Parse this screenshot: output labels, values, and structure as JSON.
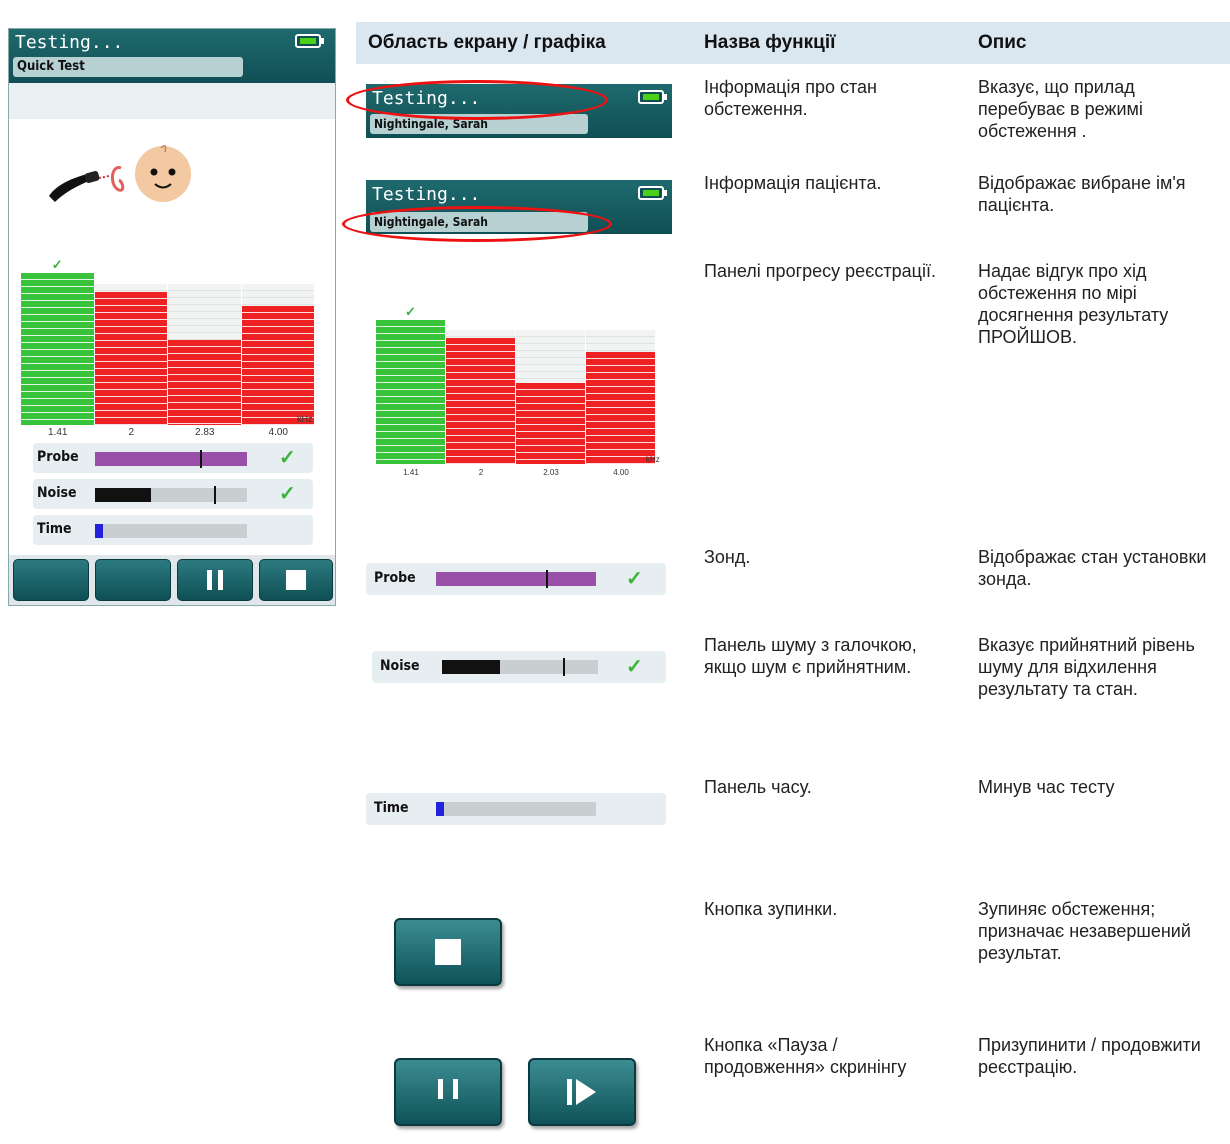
{
  "device": {
    "status_title": "Testing...",
    "test_name": "Quick Test",
    "bar_chart": {
      "frequencies": [
        "1.41",
        "2",
        "2.83",
        "4.00"
      ],
      "unit": "kHz",
      "bars": [
        {
          "freq": "1.41",
          "level": 1.0,
          "color": "#39c33a",
          "passed": true
        },
        {
          "freq": "2",
          "level": 0.875,
          "color": "#ee2222",
          "passed": false
        },
        {
          "freq": "2.83",
          "level": 0.56,
          "color": "#ee2222",
          "passed": false
        },
        {
          "freq": "4.00",
          "level": 0.78,
          "color": "#ee2222",
          "passed": false
        }
      ]
    },
    "meters": {
      "probe": {
        "label": "Probe",
        "fill": 1.0,
        "marker": 0.69,
        "fill_color": "#9a4fa8",
        "ok": true
      },
      "noise": {
        "label": "Noise",
        "fill": 0.37,
        "marker": 0.78,
        "fill_color": "#111111",
        "ok": true
      },
      "time": {
        "label": "Time",
        "fill": 0.05,
        "fill_color": "#2222dd",
        "ok": false
      }
    }
  },
  "table": {
    "headers": [
      "Область екрану / графіка",
      "Назва функції",
      "Опис"
    ],
    "rows": [
      {
        "graphic": {
          "status_title": "Testing...",
          "patient": "Nightingale, Sarah"
        },
        "function": "Інформація про стан обстеження.",
        "description": "Вказує, що прилад перебуває в режимі обстеження ."
      },
      {
        "graphic": {
          "status_title": "Testing...",
          "patient": "Nightingale, Sarah"
        },
        "function": "Інформація пацієнта.",
        "description": "Відображає вибране ім'я пацієнта."
      },
      {
        "graphic": {
          "frequencies": [
            "1.41",
            "2",
            "2.03",
            "4.00"
          ],
          "unit": "kHz"
        },
        "function": "Панелі прогресу реєстрації.",
        "description": "Надає відгук про хід обстеження по мірі досягнення результату ПРОЙШОВ."
      },
      {
        "graphic": {
          "label": "Probe"
        },
        "function": "Зонд.",
        "description": "Відображає стан установки зонда."
      },
      {
        "graphic": {
          "label": "Noise"
        },
        "function": "Панель шуму з галочкою, якщо шум є прийнятним.",
        "description": "Вказує прийнятний рівень шуму для відхилення результату та стан."
      },
      {
        "graphic": {
          "label": "Time"
        },
        "function": "Панель часу.",
        "description": "Минув час тесту"
      },
      {
        "graphic": {
          "button": "stop"
        },
        "function": "Кнопка зупинки.",
        "description": "Зупиняє обстеження; призначає незавершений результат."
      },
      {
        "graphic": {
          "button": "pause-resume"
        },
        "function": "Кнопка «Пауза / продовження» скринінгу",
        "description": "Призупинити / продовжити реєстрацію."
      }
    ]
  },
  "colors": {
    "header_teal": "#0f4f55",
    "highlight_red": "#e11111",
    "table_header_bg": "#dbe7f0"
  }
}
